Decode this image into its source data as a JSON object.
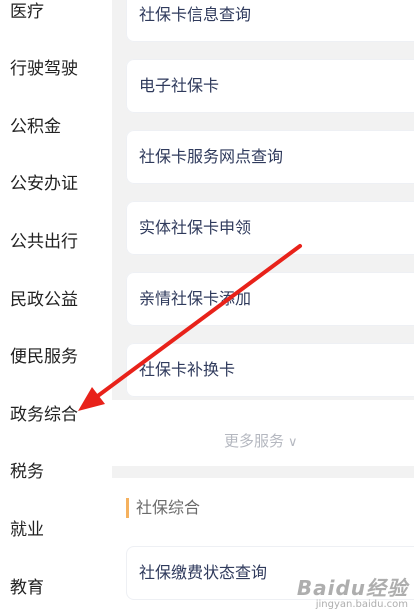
{
  "sidebar": {
    "items": [
      {
        "label": "医疗"
      },
      {
        "label": "行驶驾驶"
      },
      {
        "label": "公积金"
      },
      {
        "label": "公安办证"
      },
      {
        "label": "公共出行"
      },
      {
        "label": "民政公益"
      },
      {
        "label": "便民服务"
      },
      {
        "label": "政务综合"
      },
      {
        "label": "税务"
      },
      {
        "label": "就业"
      },
      {
        "label": "教育"
      }
    ]
  },
  "services": [
    {
      "label": "社保卡信息查询"
    },
    {
      "label": "电子社保卡"
    },
    {
      "label": "社保卡服务网点查询"
    },
    {
      "label": "实体社保卡申领"
    },
    {
      "label": "亲情社保卡添加"
    },
    {
      "label": "社保卡补换卡"
    }
  ],
  "more": {
    "label": "更多服务"
  },
  "section": {
    "title": "社保综合",
    "items": [
      {
        "label": "社保缴费状态查询"
      }
    ]
  },
  "watermark": {
    "logo": "Baidu经验",
    "sub": "jingyan.baidu.com"
  },
  "colors": {
    "accent": "#f5b15e",
    "annotation_arrow": "#e8221a",
    "card_text": "#2f3a5c"
  }
}
